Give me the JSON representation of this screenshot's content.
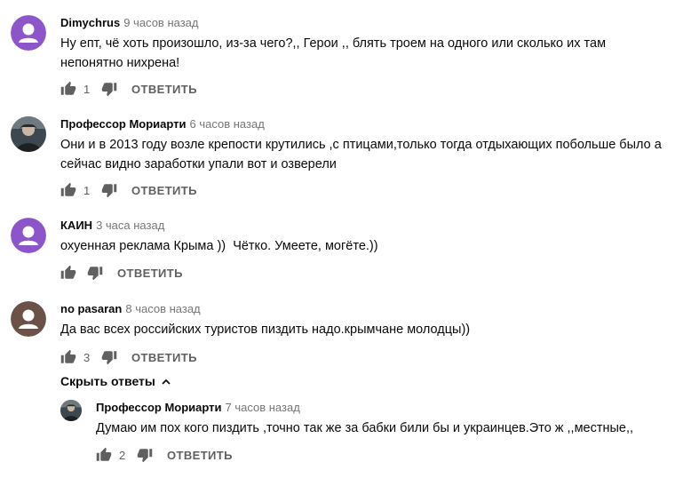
{
  "comments": [
    {
      "author": "Dimychrus",
      "time": "9 часов назад",
      "text": "Ну епт, чё хоть произошло, из-за чего?,, Герои ,, блять троем на одного или сколько их там непонятно нихрена!",
      "likes": "1",
      "reply_label": "ОТВЕТИТЬ",
      "avatar_color": "#8c55c9"
    },
    {
      "author": "Профессор Мориарти",
      "time": "6 часов назад",
      "text": "Они и в 2013 году возле крепости крутились ,с птицами,только тогда отдыхающих побольше было а сейчас видно заработки упали вот и озверели",
      "likes": "1",
      "reply_label": "ОТВЕТИТЬ",
      "avatar_color": "#3d4750"
    },
    {
      "author": "КАИН",
      "time": "3 часа назад",
      "text": "охуенная реклама Крыма ))  Чётко. Умеете, могёте.))",
      "likes": "",
      "reply_label": "ОТВЕТИТЬ",
      "avatar_color": "#8c55c9"
    },
    {
      "author": "no pasaran",
      "time": "8 часов назад",
      "text": "Да вас всех российских туристов пиздить надо.крымчане молодцы))",
      "likes": "3",
      "reply_label": "ОТВЕТИТЬ",
      "avatar_color": "#6b5148"
    }
  ],
  "hide_replies_label": "Скрыть ответы",
  "reply": {
    "author": "Профессор Мориарти",
    "time": "7 часов назад",
    "text": "Думаю им пох кого пиздить ,точно так же за бабки били бы и украинцев.Это ж ,,местные,,",
    "likes": "2",
    "reply_label": "ОТВЕТИТЬ"
  },
  "icons": {
    "like": "thumb-up-icon",
    "dislike": "thumb-down-icon",
    "chevron": "chevron-up-icon",
    "avatar_placeholder": "person-icon"
  }
}
